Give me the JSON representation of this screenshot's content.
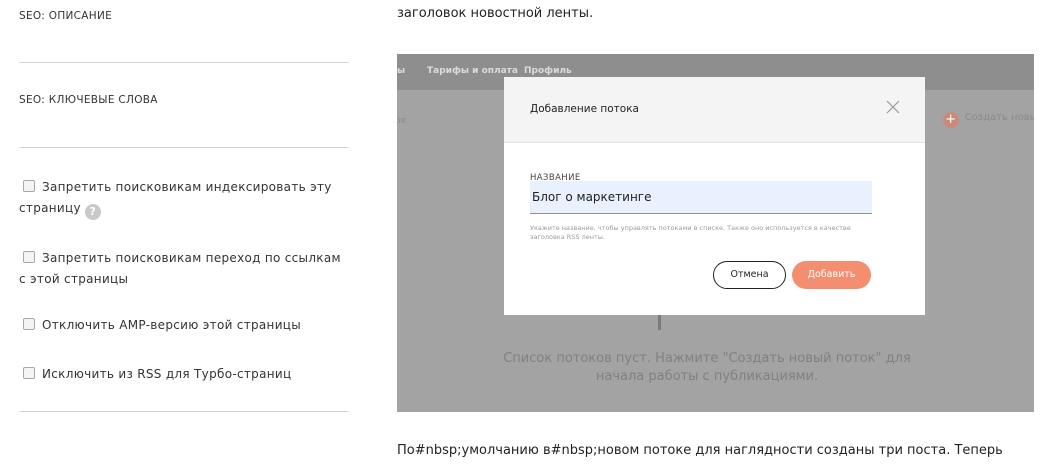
{
  "settings": {
    "seo_description_label": "SEO: ОПИСАНИЕ",
    "seo_keywords_label": "SEO: КЛЮЧЕВЫЕ СЛОВА",
    "checkboxes": [
      {
        "line1": "Запретить поисковикам индексировать эту",
        "line2": "страницу",
        "checked": false
      },
      {
        "line1": "Запретить поисковикам переход по ссылкам",
        "line2": "с этой страницы",
        "checked": false
      },
      {
        "line1": "Отключить AMP-версию этой страницы",
        "checked": false
      },
      {
        "line1": "Исключить из RSS для Турбо-страниц",
        "checked": false
      }
    ],
    "help_glyph": "?"
  },
  "article": {
    "top_text": "заголовок новостной ленты.",
    "bottom_text": "По#nbsp;умолчанию в#nbsp;новом потоке для наглядности созданы три поста. Теперь"
  },
  "screenshot": {
    "nav": [
      "ы",
      "Тарифы и оплата",
      "Профиль"
    ],
    "create_label": "Создать новый",
    "ghost_left": "ов",
    "empty_text": "Список потоков пуст. Нажмите \"Создать новый поток\" для начала работы с публикациями.",
    "modal": {
      "title": "Добавление потока",
      "name_label": "НАЗВАНИЕ",
      "name_value": "Блог о маркетинге",
      "hint": "Укажите название, чтобы управлять потоками в списке. Также оно используется в качестве заголовка RSS ленты.",
      "cancel_label": "Отмена",
      "add_label": "Добавить"
    }
  },
  "colors": {
    "accent": "#f48e71",
    "overlay": "#a3a3a3",
    "input_bg": "#e9f0fe"
  }
}
